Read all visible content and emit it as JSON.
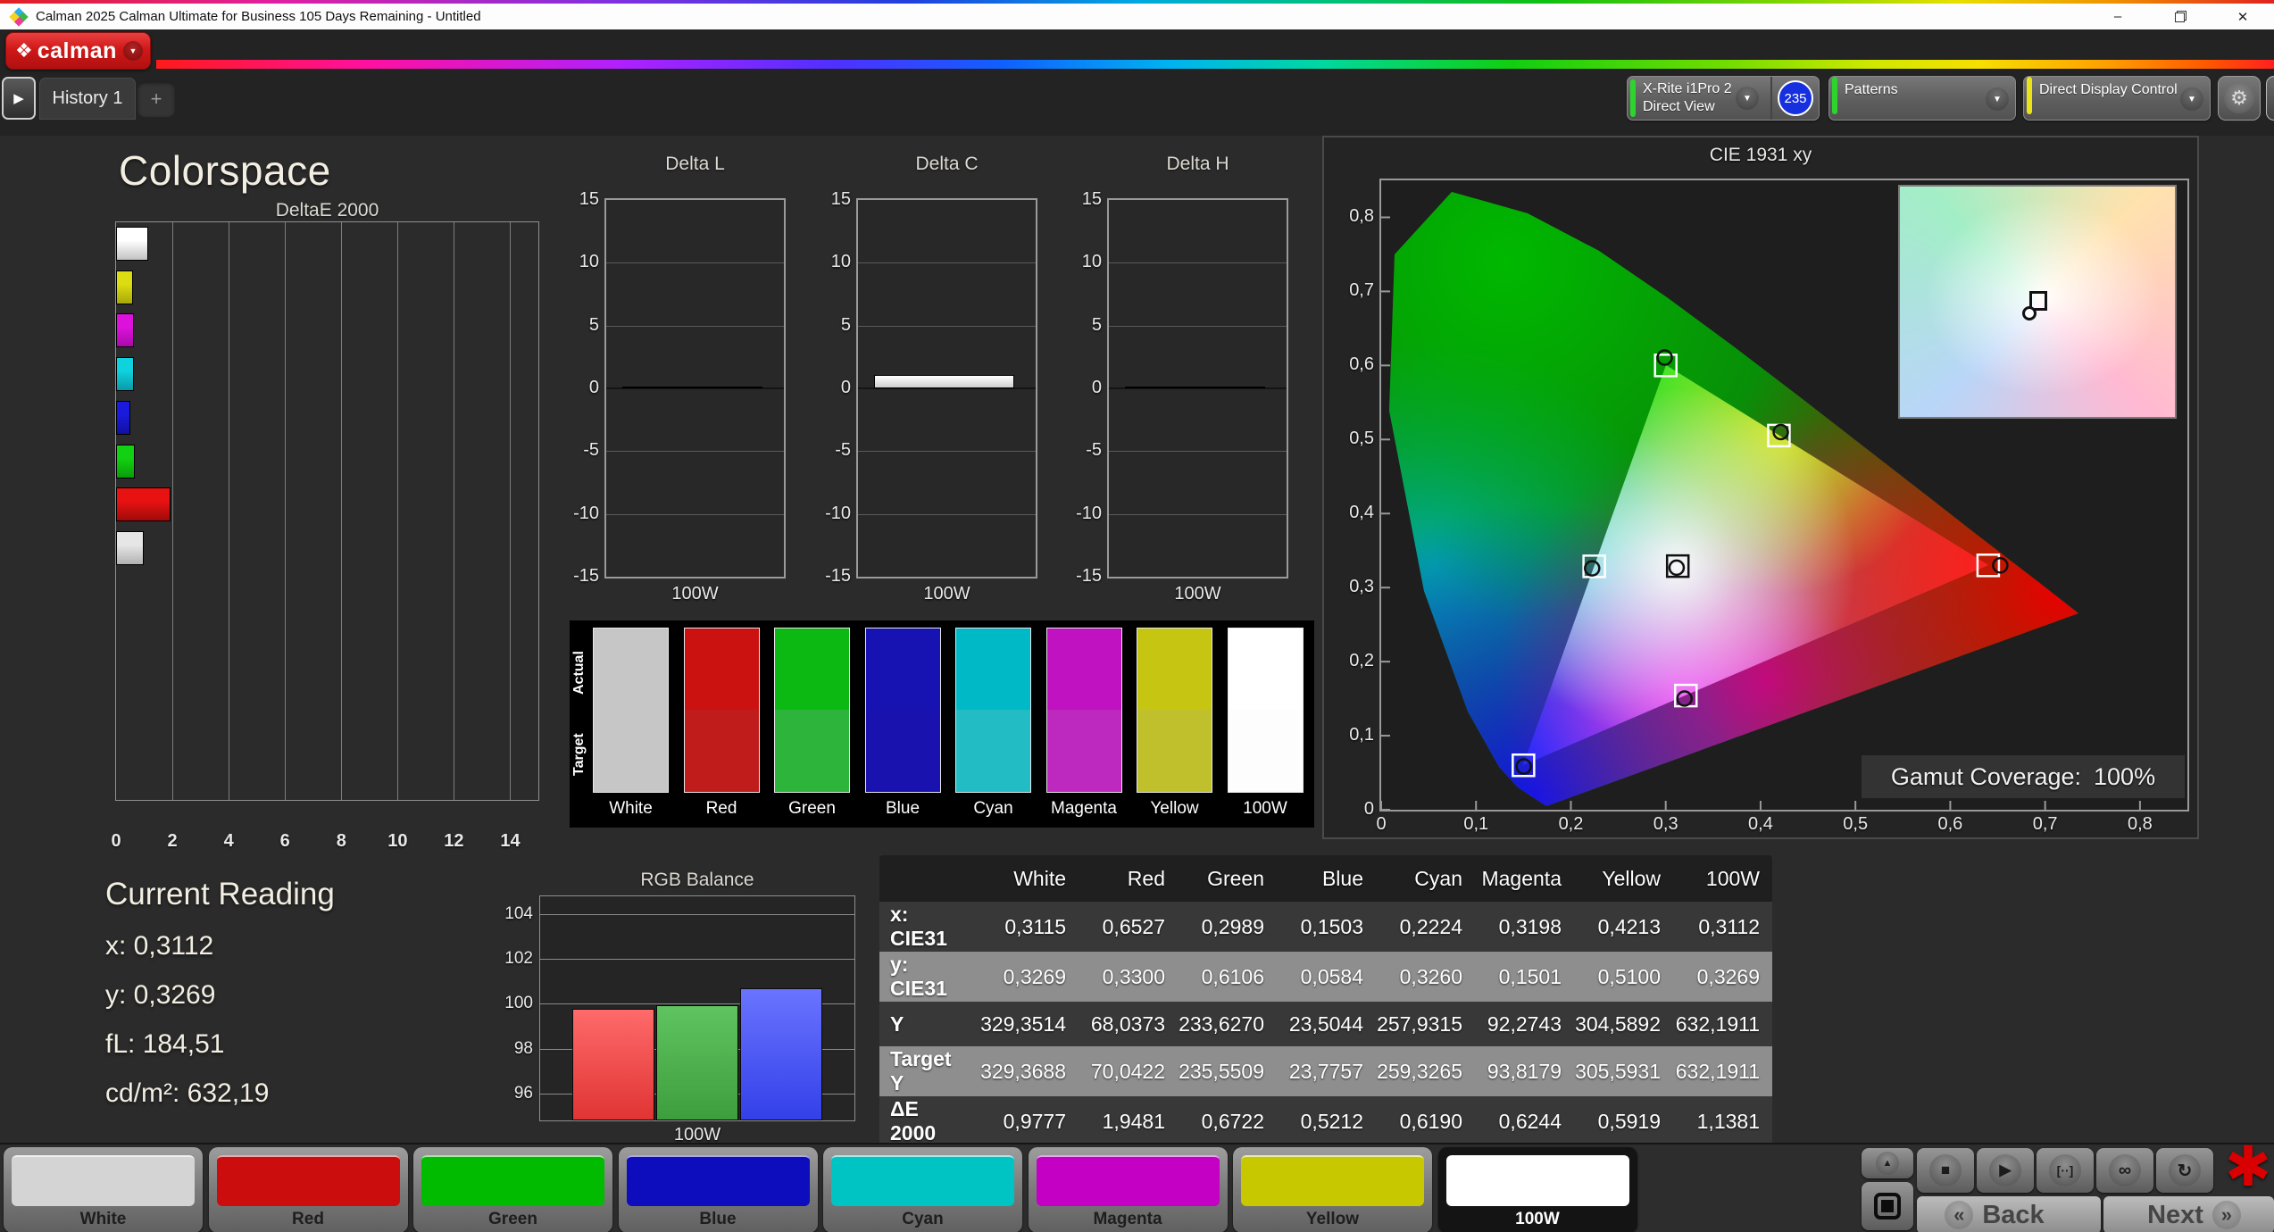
{
  "title_bar": {
    "title": "Calman 2025 Calman Ultimate for Business 105 Days Remaining  - Untitled",
    "minimize": "–",
    "close": "✕"
  },
  "header": {
    "logo": {
      "icon": "❖",
      "text": "calman",
      "caret": "▼"
    },
    "caret": "▼",
    "tabs": {
      "nav": "▶",
      "history": "History 1",
      "add": "+"
    },
    "meter": {
      "line1": "X-Rite i1Pro 2",
      "line2": "Direct View",
      "badge": "235"
    },
    "patterns": {
      "label": "Patterns"
    },
    "display_control": {
      "label": "Direct Display Control"
    },
    "settings_icon": "⚙",
    "collapse_icon": "◀"
  },
  "page": {
    "heading": "Colorspace"
  },
  "current_reading": {
    "title": "Current Reading",
    "lines": [
      {
        "label": "x:",
        "value": "0,3112"
      },
      {
        "label": "y:",
        "value": "0,3269"
      },
      {
        "label": "fL:",
        "value": "184,51"
      },
      {
        "label": "cd/m²:",
        "value": "632,19"
      }
    ]
  },
  "swatch_panel": {
    "actual_label": "Actual",
    "target_label": "Target",
    "columns": [
      {
        "name": "White",
        "actual": "#c6c6c6",
        "target": "#c6c6c6"
      },
      {
        "name": "Red",
        "actual": "#cc1111",
        "target": "#c01c1c"
      },
      {
        "name": "Green",
        "actual": "#0bb912",
        "target": "#2db43a"
      },
      {
        "name": "Blue",
        "actual": "#1713b2",
        "target": "#1a12ae"
      },
      {
        "name": "Cyan",
        "actual": "#00b9c6",
        "target": "#22bcc4"
      },
      {
        "name": "Magenta",
        "actual": "#c012c0",
        "target": "#bd28bf"
      },
      {
        "name": "Yellow",
        "actual": "#c6c612",
        "target": "#c0c02d"
      },
      {
        "name": "100W",
        "actual": "#ffffff",
        "target": "#fdfdfd"
      }
    ]
  },
  "table": {
    "headers": [
      "",
      "White",
      "Red",
      "Green",
      "Blue",
      "Cyan",
      "Magenta",
      "Yellow",
      "100W"
    ],
    "rows": [
      {
        "label": "x: CIE31",
        "shaded": false,
        "values": [
          "0,3115",
          "0,6527",
          "0,2989",
          "0,1503",
          "0,2224",
          "0,3198",
          "0,4213",
          "0,3112"
        ]
      },
      {
        "label": "y: CIE31",
        "shaded": true,
        "values": [
          "0,3269",
          "0,3300",
          "0,6106",
          "0,0584",
          "0,3260",
          "0,1501",
          "0,5100",
          "0,3269"
        ]
      },
      {
        "label": "Y",
        "shaded": false,
        "values": [
          "329,3514",
          "68,0373",
          "233,6270",
          "23,5044",
          "257,9315",
          "92,2743",
          "304,5892",
          "632,1911"
        ]
      },
      {
        "label": "Target Y",
        "shaded": true,
        "values": [
          "329,3688",
          "70,0422",
          "235,5509",
          "23,7757",
          "259,3265",
          "93,8179",
          "305,5931",
          "632,1911"
        ]
      },
      {
        "label": "ΔE 2000",
        "shaded": false,
        "values": [
          "0,9777",
          "1,9481",
          "0,6722",
          "0,5212",
          "0,6190",
          "0,6244",
          "0,5919",
          "1,1381"
        ]
      }
    ]
  },
  "pattern_buttons": [
    {
      "label": "White",
      "color": "#d4d4d4",
      "selected": false
    },
    {
      "label": "Red",
      "color": "#cc0d0d",
      "selected": false
    },
    {
      "label": "Green",
      "color": "#00bb00",
      "selected": false
    },
    {
      "label": "Blue",
      "color": "#0d0dbd",
      "selected": false
    },
    {
      "label": "Cyan",
      "color": "#00c4c4",
      "selected": false
    },
    {
      "label": "Magenta",
      "color": "#c400c4",
      "selected": false
    },
    {
      "label": "Yellow",
      "color": "#c8c800",
      "selected": false
    },
    {
      "label": "100W",
      "color": "#ffffff",
      "selected": true
    }
  ],
  "transport": {
    "up_icon": "▲",
    "stop_icon": "■",
    "play_icon": "▶",
    "measure_icon": "[··]",
    "continuous_icon": "∞",
    "loop_icon": "↻",
    "asterisk_icon": "✱",
    "back_chevron": "«",
    "back_label": "Back",
    "next_label": "Next",
    "next_chevron": "»"
  },
  "chart_data": [
    {
      "type": "bar",
      "orientation": "horizontal",
      "title": "DeltaE 2000",
      "categories": [
        "100W",
        "Yellow",
        "Magenta",
        "Cyan",
        "Blue",
        "Green",
        "Red",
        "White"
      ],
      "values": [
        1.1381,
        0.5919,
        0.6244,
        0.619,
        0.5212,
        0.6722,
        1.9481,
        0.9777
      ],
      "bar_colors": [
        [
          "#ffffff",
          "#c2c2c2"
        ],
        [
          "#dcdc12",
          "#a8a80a"
        ],
        [
          "#dc12dc",
          "#a80aa8"
        ],
        [
          "#0ed2de",
          "#0a9aa8"
        ],
        [
          "#1a1adc",
          "#1010a0"
        ],
        [
          "#12d012",
          "#0a9c0a"
        ],
        [
          "#e81212",
          "#a00a0a"
        ],
        [
          "#e6e6e6",
          "#b2b2b2"
        ]
      ],
      "xlim": [
        0,
        15
      ],
      "xticks": [
        0,
        2,
        4,
        6,
        8,
        10,
        12,
        14
      ]
    },
    {
      "type": "bar",
      "title": "Delta L",
      "categories": [
        "100W"
      ],
      "values": [
        0.05
      ],
      "ylim": [
        -15,
        15
      ],
      "yticks": [
        15,
        10,
        5,
        0,
        -5,
        -10,
        -15
      ]
    },
    {
      "type": "bar",
      "title": "Delta C",
      "categories": [
        "100W"
      ],
      "values": [
        1.1
      ],
      "ylim": [
        -15,
        15
      ],
      "yticks": [
        15,
        10,
        5,
        0,
        -5,
        -10,
        -15
      ]
    },
    {
      "type": "bar",
      "title": "Delta H",
      "categories": [
        "100W"
      ],
      "values": [
        0.05
      ],
      "ylim": [
        -15,
        15
      ],
      "yticks": [
        15,
        10,
        5,
        0,
        -5,
        -10,
        -15
      ]
    },
    {
      "type": "bar",
      "title": "RGB Balance",
      "categories": [
        "100W"
      ],
      "series": [
        {
          "name": "Red",
          "values": [
            99.8
          ],
          "colors": [
            "#ff6a6a",
            "#e03434"
          ]
        },
        {
          "name": "Green",
          "values": [
            99.95
          ],
          "colors": [
            "#5fc45f",
            "#3d9e3d"
          ]
        },
        {
          "name": "Blue",
          "values": [
            100.7
          ],
          "colors": [
            "#6a74ff",
            "#3340e8"
          ]
        }
      ],
      "ylim": [
        94.8,
        104.8
      ],
      "yticks": [
        104,
        102,
        100,
        98,
        96
      ]
    },
    {
      "type": "scatter",
      "title": "CIE 1931 xy",
      "xlim": [
        0,
        0.85
      ],
      "ylim": [
        0,
        0.85
      ],
      "xtick_labels": [
        "0",
        "0,1",
        "0,2",
        "0,3",
        "0,4",
        "0,5",
        "0,6",
        "0,7",
        "0,8"
      ],
      "ytick_labels": [
        "0",
        "0,1",
        "0,2",
        "0,3",
        "0,4",
        "0,5",
        "0,6",
        "0,7",
        "0,8"
      ],
      "gamut_label": "Gamut Coverage:",
      "gamut_value": "100%",
      "points": [
        {
          "name": "White",
          "target": [
            0.3127,
            0.329
          ],
          "measured": [
            0.3115,
            0.3269
          ],
          "marker": "black"
        },
        {
          "name": "Red",
          "target": [
            0.64,
            0.33
          ],
          "measured": [
            0.6527,
            0.33
          ],
          "marker": "white"
        },
        {
          "name": "Green",
          "target": [
            0.3,
            0.6
          ],
          "measured": [
            0.2989,
            0.6106
          ],
          "marker": "white"
        },
        {
          "name": "Blue",
          "target": [
            0.15,
            0.06
          ],
          "measured": [
            0.1503,
            0.0584
          ],
          "marker": "white"
        },
        {
          "name": "Cyan",
          "target": [
            0.2246,
            0.3287
          ],
          "measured": [
            0.2224,
            0.326
          ],
          "marker": "white"
        },
        {
          "name": "Magenta",
          "target": [
            0.3212,
            0.1542
          ],
          "measured": [
            0.3198,
            0.1501
          ],
          "marker": "white"
        },
        {
          "name": "Yellow",
          "target": [
            0.4193,
            0.5053
          ],
          "measured": [
            0.4213,
            0.51
          ],
          "marker": "white"
        }
      ]
    }
  ]
}
